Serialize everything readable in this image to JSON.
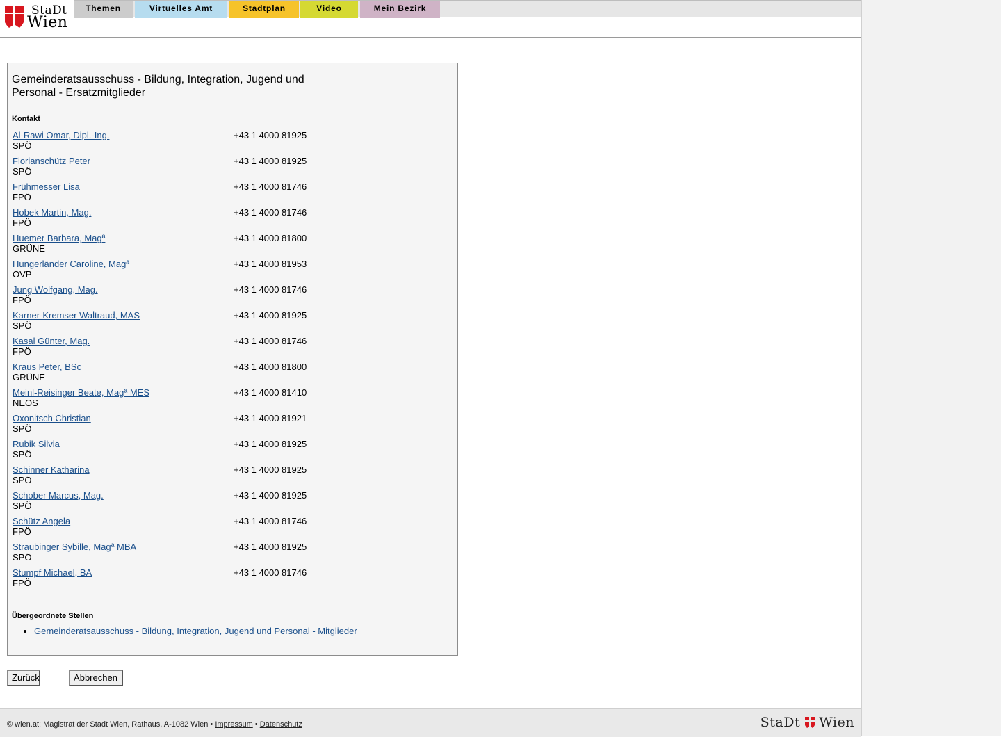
{
  "logo": {
    "line1": "StaDt",
    "line2": "Wien"
  },
  "nav": {
    "tabs": [
      {
        "label": "Themen",
        "color": "#cccccc"
      },
      {
        "label": "Virtuelles Amt",
        "color": "#b6dcef"
      },
      {
        "label": "Stadtplan",
        "color": "#f6c32a"
      },
      {
        "label": "Video",
        "color": "#d5d933"
      },
      {
        "label": "Mein Bezirk",
        "color": "#cfb3c6"
      }
    ]
  },
  "main": {
    "title": "Gemeinderatsausschuss - Bildung, Integration, Jugend und Personal - Ersatzmitglieder",
    "contact_heading": "Kontakt",
    "contacts": [
      {
        "name": "Al-Rawi Omar, Dipl.-Ing.",
        "party": "SPÖ",
        "phone": "+43 1 4000 81925"
      },
      {
        "name": "Florianschütz Peter",
        "party": "SPÖ",
        "phone": "+43 1 4000 81925"
      },
      {
        "name": "Frühmesser Lisa",
        "party": "FPÖ",
        "phone": "+43 1 4000 81746"
      },
      {
        "name": "Hobek Martin, Mag.",
        "party": "FPÖ",
        "phone": "+43 1 4000 81746"
      },
      {
        "name": "Huemer Barbara, Magª",
        "party": "GRÜNE",
        "phone": "+43 1 4000 81800"
      },
      {
        "name": "Hungerländer Caroline, Magª",
        "party": "ÖVP",
        "phone": "+43 1 4000 81953"
      },
      {
        "name": "Jung Wolfgang, Mag.",
        "party": "FPÖ",
        "phone": "+43 1 4000 81746"
      },
      {
        "name": "Karner-Kremser Waltraud, MAS",
        "party": "SPÖ",
        "phone": "+43 1 4000 81925"
      },
      {
        "name": "Kasal Günter, Mag.",
        "party": "FPÖ",
        "phone": "+43 1 4000 81746"
      },
      {
        "name": "Kraus Peter, BSc",
        "party": "GRÜNE",
        "phone": "+43 1 4000 81800"
      },
      {
        "name": "Meinl-Reisinger Beate, Magª MES",
        "party": "NEOS",
        "phone": "+43 1 4000 81410"
      },
      {
        "name": "Oxonitsch Christian",
        "party": "SPÖ",
        "phone": "+43 1 4000 81921"
      },
      {
        "name": "Rubik Silvia",
        "party": "SPÖ",
        "phone": "+43 1 4000 81925"
      },
      {
        "name": "Schinner Katharina",
        "party": "SPÖ",
        "phone": "+43 1 4000 81925"
      },
      {
        "name": "Schober Marcus, Mag.",
        "party": "SPÖ",
        "phone": "+43 1 4000 81925"
      },
      {
        "name": "Schütz Angela",
        "party": "FPÖ",
        "phone": "+43 1 4000 81746"
      },
      {
        "name": "Straubinger Sybille, Magª MBA",
        "party": "SPÖ",
        "phone": "+43 1 4000 81925"
      },
      {
        "name": "Stumpf Michael, BA",
        "party": "FPÖ",
        "phone": "+43 1 4000 81746"
      }
    ],
    "parent_heading": "Übergeordnete Stellen",
    "parent_links": [
      "Gemeinderatsausschuss - Bildung, Integration, Jugend und Personal - Mitglieder"
    ]
  },
  "buttons": {
    "back": "Zurück",
    "cancel": "Abbrechen"
  },
  "footer": {
    "text": "© wien.at: Magistrat der Stadt Wien, Rathaus, A-1082 Wien •",
    "impressum": "Impressum",
    "separator": "•",
    "datenschutz": "Datenschutz",
    "logo_left": "StaDt",
    "logo_right": "Wien"
  }
}
